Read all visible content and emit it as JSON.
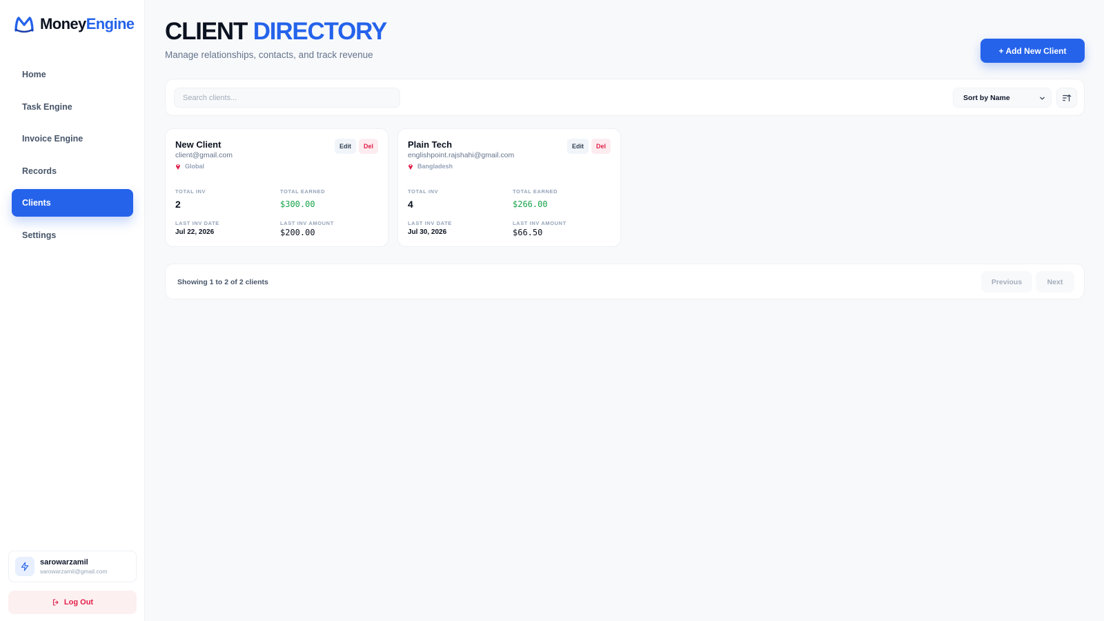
{
  "app": {
    "logo_text_primary": "Money",
    "logo_text_accent": "Engine",
    "logo_icon": "m-logo-icon"
  },
  "sidebar": {
    "items": [
      {
        "label": "Home",
        "active": false
      },
      {
        "label": "Task Engine",
        "active": false
      },
      {
        "label": "Invoice Engine",
        "active": false
      },
      {
        "label": "Records",
        "active": false
      },
      {
        "label": "Clients",
        "active": true
      },
      {
        "label": "Settings",
        "active": false
      }
    ],
    "user": {
      "name": "sarowarzamil",
      "email": "sarowarzamil@gmail.com",
      "icon": "lightning-icon"
    },
    "logout_label": "Log Out",
    "logout_icon": "logout-icon"
  },
  "header": {
    "title_primary": "CLIENT",
    "title_accent": "DIRECTORY",
    "subtitle": "Manage relationships, contacts, and track revenue",
    "add_button_label": "+ Add New Client"
  },
  "toolbar": {
    "search_placeholder": "Search clients...",
    "search_value": "",
    "sort_selected": "Sort by Name",
    "sort_direction_icon": "sort-ascending-icon"
  },
  "clients": [
    {
      "name": "New Client",
      "email": "client@gmail.com",
      "location": "Global",
      "edit_label": "Edit",
      "del_label": "Del",
      "total_inv_label": "TOTAL INV",
      "total_inv": "2",
      "total_earned_label": "TOTAL EARNED",
      "total_earned": "$300.00",
      "last_inv_date_label": "LAST INV DATE",
      "last_inv_date": "Jul 22, 2026",
      "last_inv_amount_label": "LAST INV AMOUNT",
      "last_inv_amount": "$200.00"
    },
    {
      "name": "Plain Tech",
      "email": "englishpoint.rajshahi@gmail.com",
      "location": "Bangladesh",
      "edit_label": "Edit",
      "del_label": "Del",
      "total_inv_label": "TOTAL INV",
      "total_inv": "4",
      "total_earned_label": "TOTAL EARNED",
      "total_earned": "$266.00",
      "last_inv_date_label": "LAST INV DATE",
      "last_inv_date": "Jul 30, 2026",
      "last_inv_amount_label": "LAST INV AMOUNT",
      "last_inv_amount": "$66.50"
    }
  ],
  "pagination": {
    "showing_text": "Showing 1 to 2 of 2 clients",
    "previous_label": "Previous",
    "next_label": "Next"
  },
  "colors": {
    "accent": "#2563eb",
    "danger": "#e11d48",
    "money": "#16a34a",
    "background": "#f8f9fb"
  }
}
